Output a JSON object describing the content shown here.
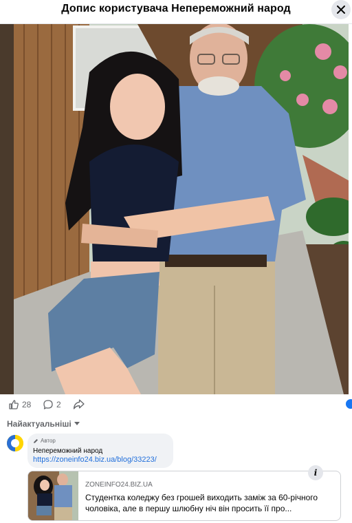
{
  "header": {
    "title": "Допис користувача Непереможний народ"
  },
  "reactions": {
    "likes": "28",
    "comments": "2"
  },
  "comments": {
    "sort_label": "Найактуальніші",
    "first": {
      "author_badge": "Автор",
      "author_name": "Непереможний народ",
      "link_text": "https://zoneinfo24.biz.ua/blog/33223/"
    }
  },
  "link_preview": {
    "domain": "ZONEINFO24.BIZ.UA",
    "title": "Студентка коледжу без грошей виходить заміж за 60-річного чоловіка, але в першу шлюбну ніч він просить її про..."
  },
  "icons": {
    "close": "close-icon",
    "like": "thumbs-up-icon",
    "comment": "comment-icon",
    "share": "share-icon",
    "sort": "chevron-down-icon",
    "author": "pencil-icon",
    "info": "info-icon"
  },
  "colors": {
    "link": "#216fdb",
    "accent": "#1877f2",
    "secondary_text": "#65676b"
  }
}
